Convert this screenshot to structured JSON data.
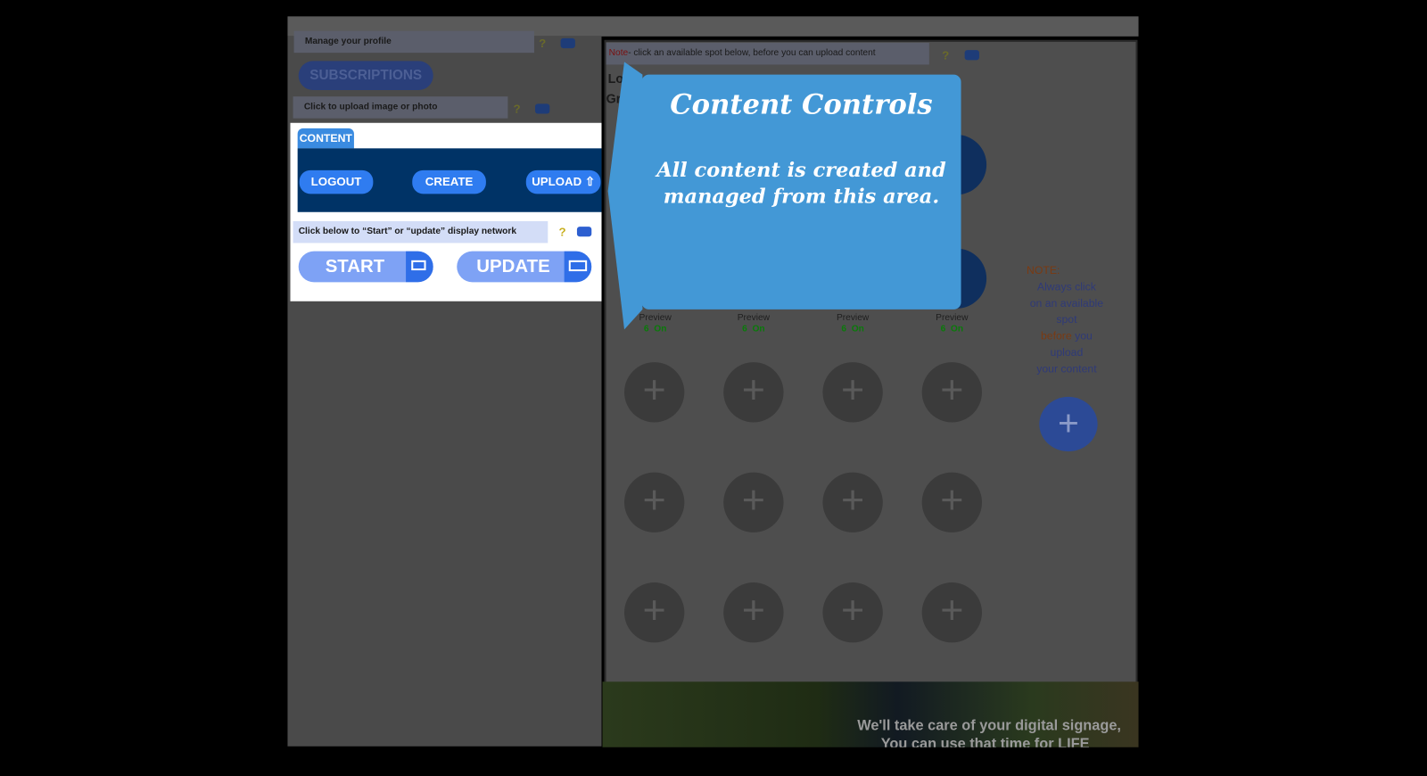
{
  "left": {
    "profile_label": "Manage your profile",
    "subscriptions_label": "SUBSCRIPTIONS",
    "upload_photo_label": "Click to upload image or photo",
    "content_tab": "CONTENT",
    "logout_label": "LOGOUT",
    "create_label": "CREATE",
    "upload_label": "UPLOAD",
    "network_label": "Click below to “Start” or “update” display  network",
    "start_label": "START",
    "update_label": "UPDATE",
    "help_glyph": "?"
  },
  "right": {
    "note_prefix": "Note",
    "note_text": "- click an available spot below, before you can upload content",
    "local_label": "Local",
    "group_label": "Group",
    "previews": [
      {
        "label": "Preview",
        "count": "6",
        "status": "On"
      },
      {
        "label": "Preview",
        "count": "6",
        "status": "On"
      },
      {
        "label": "Preview",
        "count": "6",
        "status": "On"
      },
      {
        "label": "Preview",
        "count": "6",
        "status": "On"
      }
    ],
    "plus_glyph": "+",
    "side_note": {
      "title": "NOTE:",
      "line1": "Always click",
      "line2": "on an available",
      "line3": "spot",
      "before": "before",
      "you": " you",
      "line5": "upload",
      "line6": "your content"
    }
  },
  "callout": {
    "title": "Content Controls",
    "line1": "All content is created and",
    "line2": "managed from this area."
  },
  "banner": {
    "line1": "We'll take care of your digital signage,",
    "line2": "You can use that time for LIFE"
  },
  "colors": {
    "accent": "#4398d6",
    "navy": "#003366",
    "button": "#2f7cf0"
  }
}
